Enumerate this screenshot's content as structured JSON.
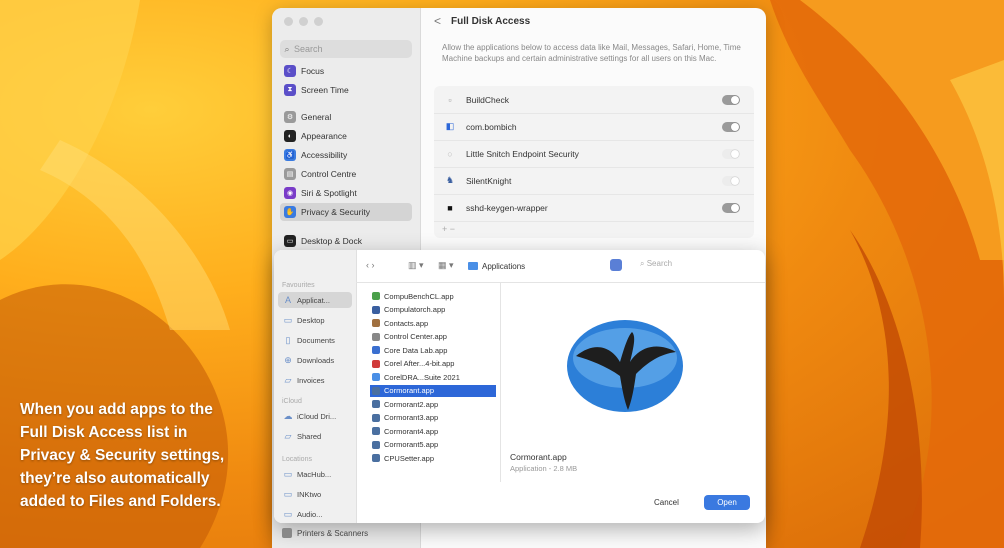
{
  "caption": {
    "lines": [
      "When you add apps to the",
      "Full Disk Access list in",
      "Privacy & Security settings,",
      "they’re also automatically",
      "added to Files and Folders."
    ]
  },
  "settings": {
    "search_placeholder": "Search",
    "sidebar_items": [
      {
        "label": "Focus",
        "color": "#5b4fc8"
      },
      {
        "label": "Screen Time",
        "color": "#5b4fc8"
      },
      {
        "label": "General",
        "color": "#9a9a9a"
      },
      {
        "label": "Appearance",
        "color": "#222222"
      },
      {
        "label": "Accessibility",
        "color": "#3a7be0"
      },
      {
        "label": "Control Centre",
        "color": "#9a9a9a"
      },
      {
        "label": "Siri & Spotlight",
        "color": "#7a3cc8"
      },
      {
        "label": "Privacy & Security",
        "color": "#3a7be0"
      },
      {
        "label": "Desktop & Dock",
        "color": "#222222"
      }
    ],
    "header_title": "Full Disk Access",
    "back_glyph": "<",
    "description": "Allow the applications below to access data like Mail, Messages, Safari, Home, Time Machine backups and certain administrative settings for all users on this Mac.",
    "apps": [
      {
        "name": "BuildCheck",
        "state": "on"
      },
      {
        "name": "com.bombich",
        "state": "on"
      },
      {
        "name": "Little Snitch Endpoint Security",
        "state": "off"
      },
      {
        "name": "SilentKnight",
        "state": "off"
      },
      {
        "name": "sshd-keygen-wrapper",
        "state": "on"
      }
    ],
    "add_remove": "+ −",
    "bottom_item": "Printers & Scanners"
  },
  "picker": {
    "sections": {
      "favourites": "Favourites",
      "icloud": "iCloud",
      "locations": "Locations"
    },
    "favourites": [
      "Applicat...",
      "Desktop",
      "Documents",
      "Downloads",
      "Invoices"
    ],
    "icloud": [
      "iCloud Dri...",
      "Shared"
    ],
    "locations": [
      "MacHub...",
      "INKtwo",
      "Audio..."
    ],
    "toolbar": {
      "nav": "‹ ›",
      "view": "▥ ▾",
      "group": "▦ ▾"
    },
    "location": "Applications",
    "search_placeholder": "Search",
    "files": [
      {
        "name": "CompuBenchCL.app",
        "color": "#4aa04a"
      },
      {
        "name": "Compulatorch.app",
        "color": "#3a5fa0"
      },
      {
        "name": "Contacts.app",
        "color": "#a07040"
      },
      {
        "name": "Control Center.app",
        "color": "#888888"
      },
      {
        "name": "Core Data Lab.app",
        "color": "#3a6fd0"
      },
      {
        "name": "Corel After...4-bit.app",
        "color": "#d03a3a"
      },
      {
        "name": "CorelDRA...Suite 2021",
        "color": "#4a8fe6"
      },
      {
        "name": "Cormorant.app",
        "color": "#4a6fa0"
      },
      {
        "name": "Cormorant2.app",
        "color": "#4a6fa0"
      },
      {
        "name": "Cormorant3.app",
        "color": "#4a6fa0"
      },
      {
        "name": "Cormorant4.app",
        "color": "#4a6fa0"
      },
      {
        "name": "Cormorant5.app",
        "color": "#4a6fa0"
      },
      {
        "name": "CPUSetter.app",
        "color": "#4a6fa0"
      }
    ],
    "selected_index": 7,
    "preview_name": "Cormorant.app",
    "preview_meta": "Application - 2.8 MB",
    "cancel_label": "Cancel",
    "open_label": "Open"
  }
}
